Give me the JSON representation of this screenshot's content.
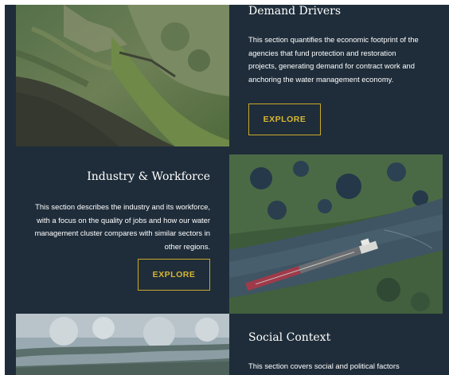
{
  "sections": [
    {
      "title": "Demand Drivers",
      "body": "This section quantifies the economic footprint of the agencies that fund protection and restoration projects, generating demand for contract work and anchoring the water management economy.",
      "button_label": "EXPLORE"
    },
    {
      "title": "Industry & Workforce",
      "body": "This section describes the industry and its workforce, with a focus on the quality of jobs and how our water management cluster compares with similar sectors in other regions.",
      "button_label": "EXPLORE"
    },
    {
      "title": "Social Context",
      "body": "This section covers social and political factors"
    }
  ],
  "colors": {
    "background": "#1f2d3a",
    "accent": "#c9a82a",
    "text": "#ffffff"
  }
}
